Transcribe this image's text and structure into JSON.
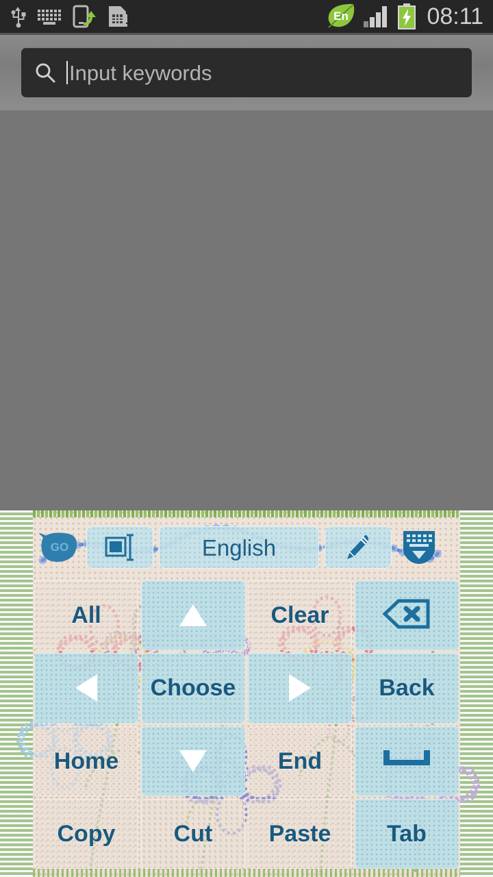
{
  "statusbar": {
    "time": "08:11",
    "left_icons": [
      {
        "name": "usb-icon",
        "label": "USB connected"
      },
      {
        "name": "keyboard-icon",
        "label": "Input method"
      },
      {
        "name": "phone-transfer-icon",
        "label": "Phone transfer"
      },
      {
        "name": "sim-card-alert-icon",
        "label": "SIM card alert"
      }
    ],
    "right_icons": [
      {
        "name": "language-badge-icon",
        "label": "En"
      },
      {
        "name": "signal-bars-icon",
        "label": "Signal",
        "bars_filled": 3,
        "bars_total": 4
      },
      {
        "name": "battery-charging-icon",
        "label": "Battery charging"
      }
    ],
    "language_badge_text": "En",
    "colors": {
      "bar_background": "#262626",
      "text": "#cfcfcf",
      "accent_green": "#8dc63f"
    }
  },
  "search": {
    "placeholder": "Input keywords",
    "value": "",
    "icon": "search-icon",
    "caret_visible": true,
    "colors": {
      "field_background": "#2b2b2b",
      "placeholder_text": "#b4b4b4",
      "zone_background": "#848484"
    }
  },
  "content": {
    "background": "#767676"
  },
  "keyboard": {
    "theme_name": "embroidery-flowers",
    "toolbar": {
      "logo": {
        "name": "go-keyboard-logo",
        "text": "GO"
      },
      "buttons": [
        {
          "name": "layout-resize-button",
          "icon": "resize-layout-icon",
          "label": ""
        },
        {
          "name": "language-button",
          "icon": "",
          "label": "English"
        },
        {
          "name": "edit-pen-button",
          "icon": "pen-edit-icon",
          "label": ""
        }
      ],
      "hide_keyboard": {
        "name": "hide-keyboard-button",
        "icon": "keyboard-down-icon"
      }
    },
    "rows": [
      [
        {
          "name": "key-all",
          "label": "All",
          "icon": "",
          "style": "beige"
        },
        {
          "name": "key-arrow-up",
          "label": "",
          "icon": "arrow-up-icon",
          "style": "blue"
        },
        {
          "name": "key-clear",
          "label": "Clear",
          "icon": "",
          "style": "beige"
        },
        {
          "name": "key-backspace",
          "label": "",
          "icon": "backspace-icon",
          "style": "blue"
        }
      ],
      [
        {
          "name": "key-arrow-left",
          "label": "",
          "icon": "arrow-left-icon",
          "style": "blue"
        },
        {
          "name": "key-choose",
          "label": "Choose",
          "icon": "",
          "style": "blue"
        },
        {
          "name": "key-arrow-right",
          "label": "",
          "icon": "arrow-right-icon",
          "style": "blue"
        },
        {
          "name": "key-back",
          "label": "Back",
          "icon": "",
          "style": "blue"
        }
      ],
      [
        {
          "name": "key-home",
          "label": "Home",
          "icon": "",
          "style": "beige"
        },
        {
          "name": "key-arrow-down",
          "label": "",
          "icon": "arrow-down-icon",
          "style": "blue"
        },
        {
          "name": "key-end",
          "label": "End",
          "icon": "",
          "style": "beige"
        },
        {
          "name": "key-space",
          "label": "",
          "icon": "space-bar-icon",
          "style": "blue"
        }
      ],
      [
        {
          "name": "key-copy",
          "label": "Copy",
          "icon": "",
          "style": "beige"
        },
        {
          "name": "key-cut",
          "label": "Cut",
          "icon": "",
          "style": "beige"
        },
        {
          "name": "key-paste",
          "label": "Paste",
          "icon": "",
          "style": "beige"
        },
        {
          "name": "key-tab",
          "label": "Tab",
          "icon": "",
          "style": "blue"
        }
      ]
    ],
    "colors": {
      "key_text": "#19597f",
      "key_blue": "#bade e7",
      "key_beige": "#ece2d8",
      "canvas": "#eee3d8",
      "edge_green": "#8cb478",
      "stitch_blue": "#3f6fd0",
      "flower_red": "#e38a90",
      "flower_yellow": "#e8d56a",
      "flower_purple": "#9a92d8",
      "stem_green": "#7fae5c"
    }
  }
}
